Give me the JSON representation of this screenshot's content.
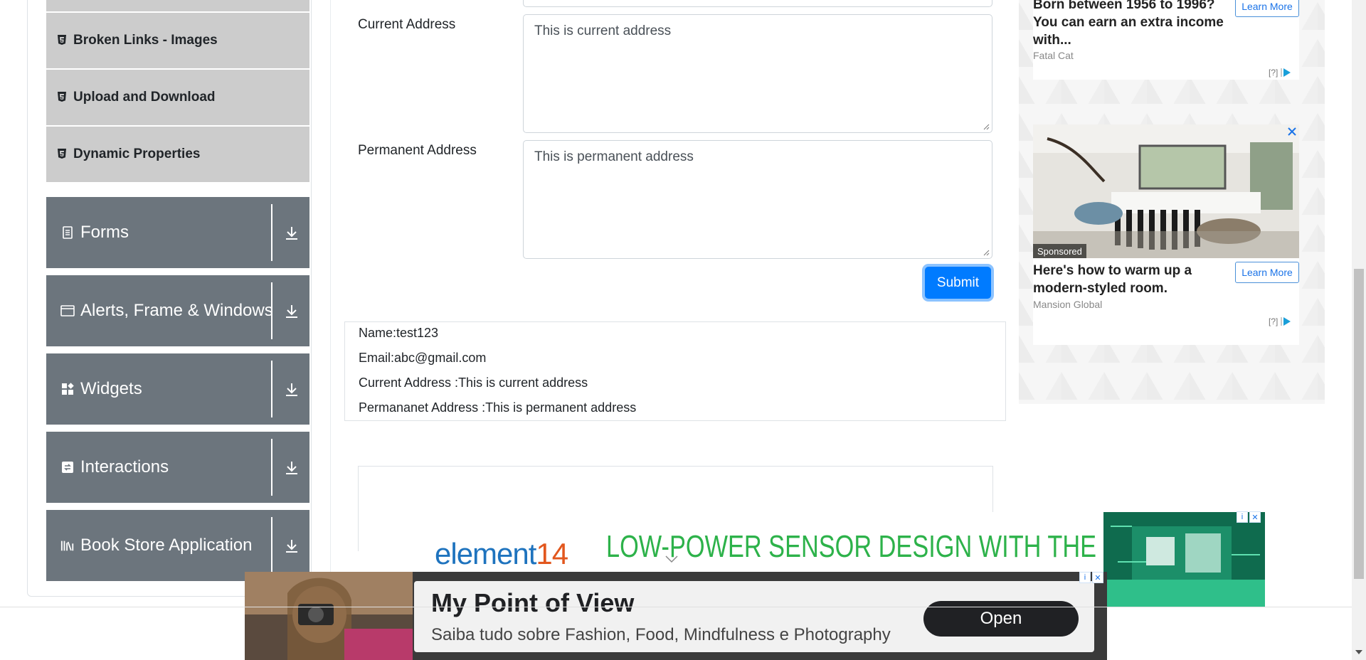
{
  "sidebar": {
    "elements_items": [
      {
        "label": "Broken Links - Images"
      },
      {
        "label": "Upload and Download"
      },
      {
        "label": "Dynamic Properties"
      }
    ],
    "groups": [
      {
        "label": "Forms",
        "icon": "form-icon"
      },
      {
        "label": "Alerts, Frame & Windows",
        "icon": "window-icon"
      },
      {
        "label": "Widgets",
        "icon": "widgets-icon"
      },
      {
        "label": "Interactions",
        "icon": "interactions-icon"
      },
      {
        "label": "Book Store Application",
        "icon": "books-icon"
      }
    ]
  },
  "form": {
    "current_address_label": "Current Address",
    "current_address_value": "This is current address",
    "permanent_address_label": "Permanent Address",
    "permanent_address_value": "This is permanent address",
    "submit_label": "Submit"
  },
  "output": {
    "name": "Name:test123",
    "email": "Email:abc@gmail.com",
    "current_address": "Current Address :This is current address",
    "permanent_address": "Permananet Address :This is permanent address"
  },
  "ads": {
    "top": {
      "headline": "Born between 1956 to 1996? You can earn an extra income with...",
      "source": "Fatal Cat",
      "cta": "Learn More",
      "adchoice": "[?]"
    },
    "second": {
      "badge": "Sponsored",
      "headline": "Here's how to warm up a modern-styled room.",
      "source": "Mansion Global",
      "cta": "Learn More",
      "adchoice": "[?]"
    },
    "banner": {
      "brand_prefix": "element",
      "brand_number": "14",
      "text": "LOW-POWER SENSOR DESIGN WITH THE"
    },
    "bottom": {
      "title": "My Point of View",
      "subtitle": "Saiba tudo sobre Fashion, Food, Mindfulness e Photography",
      "cta": "Open"
    }
  },
  "colors": {
    "group_bg": "#6c757d",
    "item_bg": "#cccccc",
    "submit": "#007bff"
  }
}
